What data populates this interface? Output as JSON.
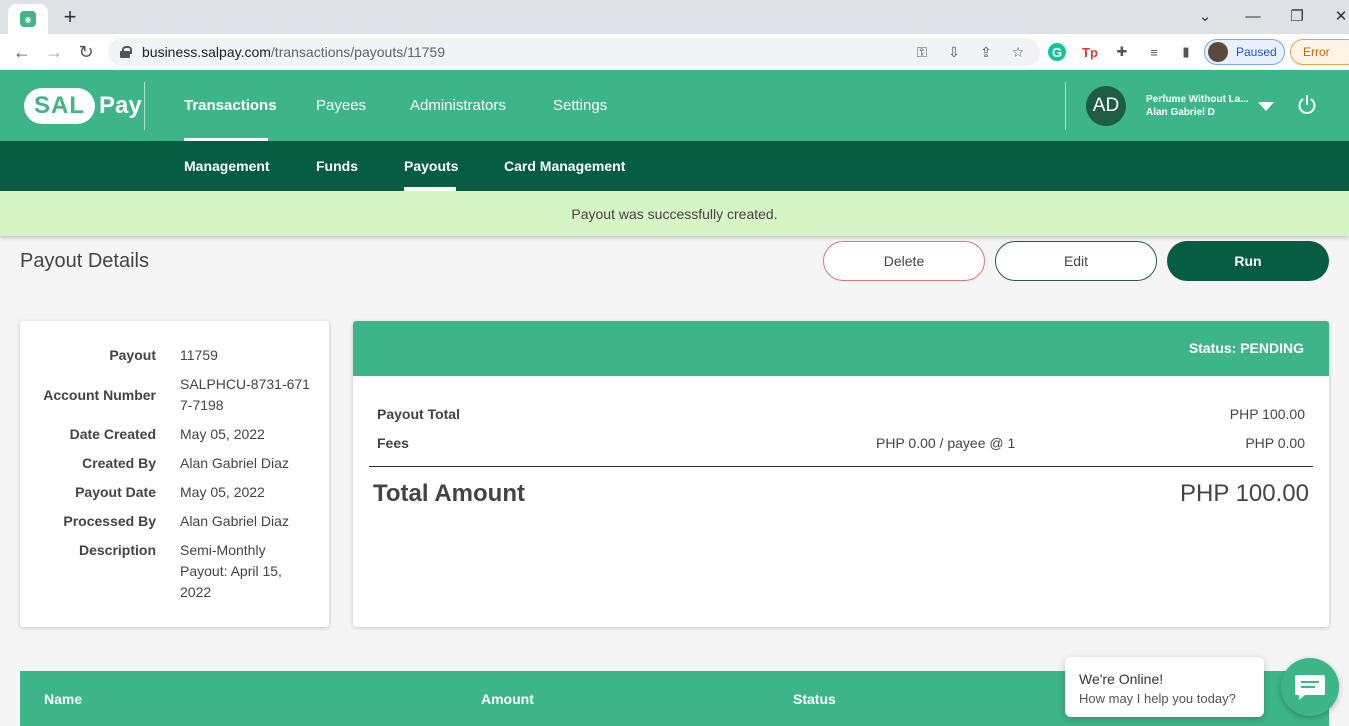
{
  "browser": {
    "url_host": "business.salpay.com",
    "url_path": "/transactions/payouts/11759",
    "profile_label": "Paused",
    "error_label": "Error",
    "new_tab_glyph": "+"
  },
  "header": {
    "logo_sal": "SAL",
    "logo_pay": "Pay",
    "nav": [
      {
        "label": "Transactions",
        "active": true
      },
      {
        "label": "Payees",
        "active": false
      },
      {
        "label": "Administrators",
        "active": false
      },
      {
        "label": "Settings",
        "active": false
      }
    ],
    "avatar_initials": "AD",
    "business_name": "Perfume Without La...",
    "user_name": "Alan Gabriel D"
  },
  "subnav": [
    {
      "label": "Management",
      "active": false
    },
    {
      "label": "Funds",
      "active": false
    },
    {
      "label": "Payouts",
      "active": true
    },
    {
      "label": "Card Management",
      "active": false
    }
  ],
  "banner": {
    "message": "Payout was successfully created."
  },
  "page": {
    "title": "Payout Details",
    "buttons": {
      "delete": "Delete",
      "edit": "Edit",
      "run": "Run"
    }
  },
  "details": {
    "payout_label": "Payout",
    "payout_value": "11759",
    "account_label": "Account Number",
    "account_value": "SALPHCU-8731-6717-7198",
    "date_created_label": "Date Created",
    "date_created_value": "May 05, 2022",
    "created_by_label": "Created By",
    "created_by_value": "Alan Gabriel Diaz",
    "payout_date_label": "Payout Date",
    "payout_date_value": "May 05, 2022",
    "processed_by_label": "Processed By",
    "processed_by_value": "Alan Gabriel Diaz",
    "description_label": "Description",
    "description_value": "Semi-Monthly Payout: April 15, 2022"
  },
  "summary": {
    "status": "Status: PENDING",
    "payout_total_label": "Payout Total",
    "payout_total_value": "PHP 100.00",
    "fees_label": "Fees",
    "fees_rate": "PHP 0.00 / payee @ 1",
    "fees_value": "PHP 0.00",
    "total_label": "Total Amount",
    "total_value": "PHP 100.00"
  },
  "table": {
    "columns": [
      "Name",
      "Amount",
      "Status"
    ]
  },
  "chat": {
    "title": "We're Online!",
    "subtitle": "How may I help you today?"
  },
  "colors": {
    "brand_green": "#3eb489",
    "dark_green": "#075d42",
    "banner_bg": "#d6f5c4"
  }
}
